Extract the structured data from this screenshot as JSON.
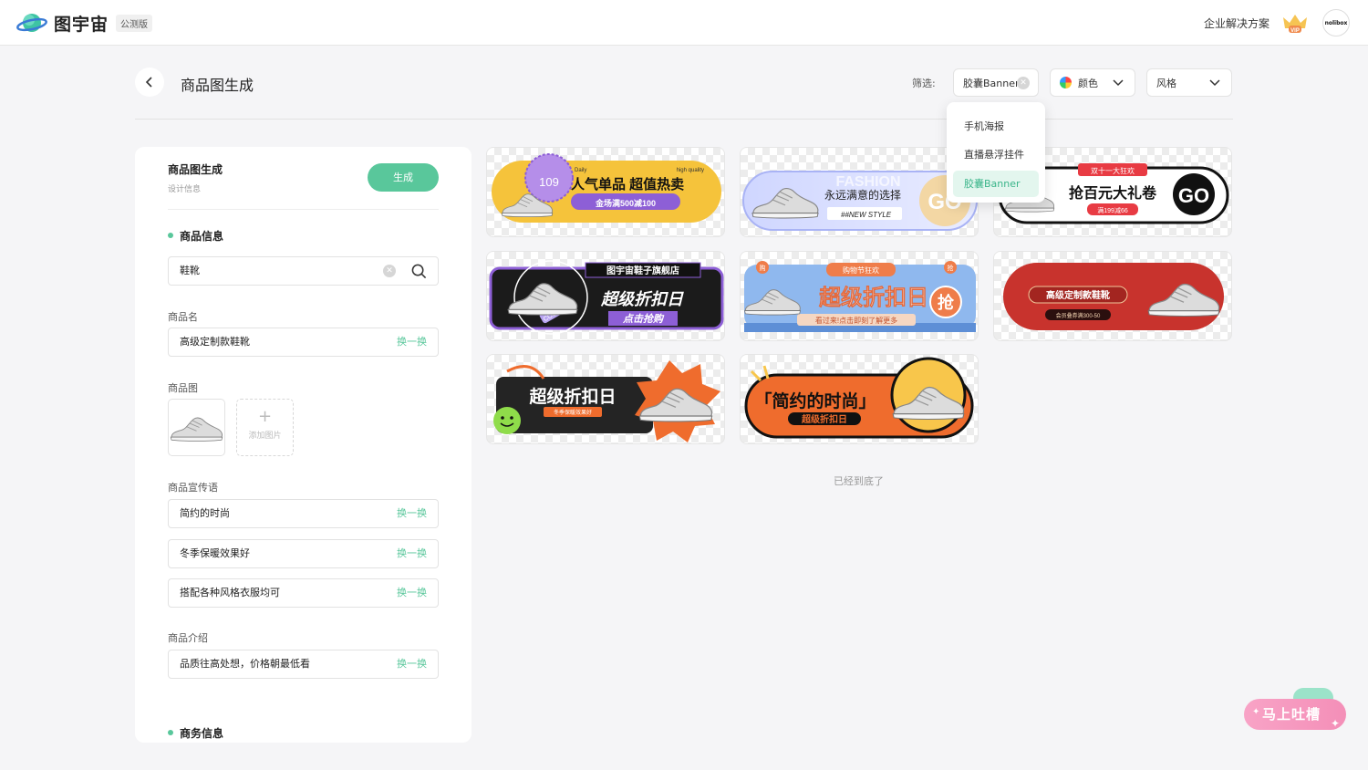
{
  "header": {
    "brand": "图宇宙",
    "badge": "公测版",
    "enterprise_link": "企业解决方案",
    "vip_label": "VIP",
    "avatar_text": "nolibox"
  },
  "page": {
    "title": "商品图生成",
    "filter_label": "筛选:",
    "filter_type_value": "胶囊Banner",
    "filter_color_label": "颜色",
    "filter_style_label": "风格"
  },
  "dropdown": {
    "items": [
      "手机海报",
      "直播悬浮挂件",
      "胶囊Banner"
    ],
    "selected": "胶囊Banner"
  },
  "panel": {
    "title": "商品图生成",
    "subtitle": "设计信息",
    "generate_label": "生成",
    "section_product": "商品信息",
    "search_value": "鞋靴",
    "name_label": "商品名",
    "name_value": "高级定制款鞋靴",
    "swap_label": "换一换",
    "image_label": "商品图",
    "add_image": "添加图片",
    "slogan_label": "商品宣传语",
    "slogans": [
      "简约的时尚",
      "冬季保暖效果好",
      "搭配各种风格衣服均可"
    ],
    "intro_label": "商品介绍",
    "intro_value": "品质往高处想，价格朝最低看",
    "section_business": "商务信息"
  },
  "banners": {
    "b1": {
      "badge": "109",
      "main": "人气单品 超值热卖",
      "sub": "金场满500减100",
      "tag_left": "Daily",
      "tag_right": "high quality"
    },
    "b2": {
      "main": "永远满意的选择",
      "sub": "##NEW STYLE",
      "go": "GO",
      "bg": "FASHION"
    },
    "b3": {
      "top": "双十一大狂欢",
      "main": "抢百元大礼卷",
      "sub": "满199减66",
      "go": "GO"
    },
    "b4": {
      "top": "图宇宙鞋子旗舰店",
      "main": "超级折扣日",
      "sub": "点击抢购",
      "cool": "COOL"
    },
    "b5": {
      "top": "购物节狂欢",
      "main": "超级折扣日",
      "sub": "看过来!点击即刻了解更多",
      "qiang": "抢",
      "left_tag": "购",
      "right_tag": "抢"
    },
    "b6": {
      "main": "高级定制款鞋靴",
      "sub": "会员叠券满300-50"
    },
    "b7": {
      "main": "超级折扣日",
      "sub": "冬季保暖效果好"
    },
    "b8": {
      "main": "「简约的时尚」",
      "sub": "超级折扣日"
    }
  },
  "gallery_end": "已经到底了",
  "feedback": {
    "label": "马上吐槽"
  },
  "colors": {
    "accent": "#59c79b",
    "panel_bg": "#ffffff",
    "page_bg": "#f5f5f7"
  }
}
